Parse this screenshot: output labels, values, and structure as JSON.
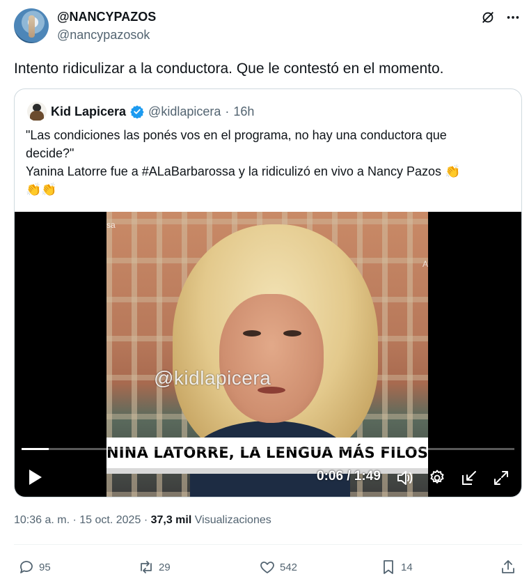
{
  "author": {
    "display_name": "@NANCYPAZOS",
    "handle": "@nancypazosok"
  },
  "tweet": {
    "text": "Intento ridiculizar a la conductora. Que le contestó en el momento."
  },
  "quoted": {
    "name": "Kid Lapicera",
    "handle": "@kidlapicera",
    "time": "16h",
    "lines": [
      "\"Las condiciones las ponés vos en el programa, no hay una conductora que",
      "decide?\"",
      "Yanina Latorre fue a #ALaBarbarossa y la ridiculizó en vivo a Nancy Pazos 👏",
      "👏👏"
    ],
    "video": {
      "overlay_handle": "@kidlapicera",
      "caption": "NINA LATORRE, LA LENGUA MÁS FILOSA DE LA TELEV",
      "time_display": "0:06 / 1:49",
      "progress": 0.055,
      "watermark_left": "sa",
      "watermark_right": "A"
    }
  },
  "meta": {
    "time": "10:36 a. m.",
    "date": "15 oct. 2025",
    "views_count": "37,3 mil",
    "views_label": "Visualizaciones"
  },
  "actions": {
    "replies": "95",
    "reposts": "29",
    "likes": "542",
    "bookmarks": "14"
  },
  "colors": {
    "text": "#0f1419",
    "secondary": "#536471",
    "verified": "#1d9bf0",
    "border": "#cfd9de"
  }
}
